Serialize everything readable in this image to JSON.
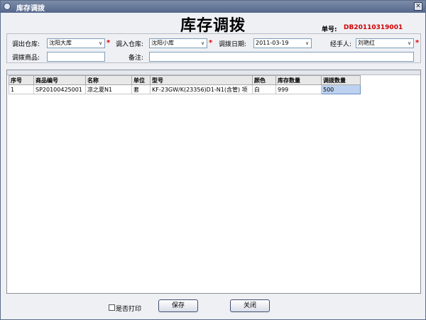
{
  "window": {
    "title": "库存调拨",
    "close_label": "✕"
  },
  "heading": "库存调拨",
  "document_number": {
    "label": "单号:",
    "value": "DB20110319001"
  },
  "form": {
    "source_warehouse_label": "调出仓库:",
    "source_warehouse_value": "沈阳大库",
    "target_warehouse_label": "调入仓库:",
    "target_warehouse_value": "沈阳小库",
    "date_label": "调拨日期:",
    "date_value": "2011-03-19",
    "handler_label": "经手人:",
    "handler_value": "刘艳红",
    "product_label": "调拨商品:",
    "product_value": "",
    "note_label": "备注:",
    "note_value": "",
    "required_mark": "*",
    "dropdown_arrow": "∨"
  },
  "table": {
    "headers": [
      "序号",
      "商品编号",
      "名称",
      "单位",
      "型号",
      "颜色",
      "库存数量",
      "调拨数量"
    ],
    "rows": [
      [
        "1",
        "SP20100425001",
        "凉之夏N1",
        "套",
        "KF-23GW/K(23356)D1-N1(含管) 项",
        "白",
        "999",
        "500"
      ]
    ]
  },
  "footer": {
    "print_label": "是否打印",
    "save_label": "保存",
    "close_label": "关闭"
  }
}
